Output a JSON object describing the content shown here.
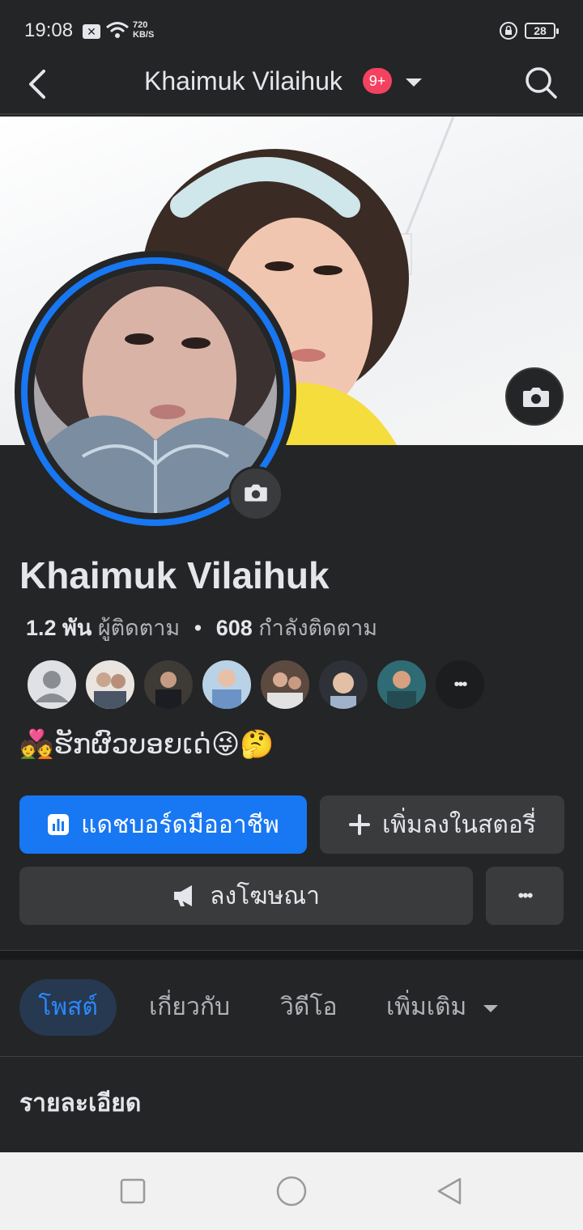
{
  "status_bar": {
    "time": "19:08",
    "speed_value": "720",
    "speed_unit": "KB/S",
    "battery": "28"
  },
  "header": {
    "title": "Khaimuk Vilaihuk",
    "badge": "9+"
  },
  "profile": {
    "name": "Khaimuk Vilaihuk",
    "followers_count": "1.2 พัน",
    "followers_label": "ผู้ติดตาม",
    "separator": "•",
    "following_count": "608",
    "following_label": "กำลังติดตาม",
    "bio": "💑ຮັກຜົວບອຍເດ່😜🤔"
  },
  "friends": {
    "more_label": "•••"
  },
  "actions": {
    "dashboard": "แดชบอร์ดมืออาชีพ",
    "add_story": "เพิ่มลงในสตอรี่",
    "advertise": "ลงโฆษณา",
    "more": "•••"
  },
  "tabs": {
    "posts": "โพสต์",
    "about": "เกี่ยวกับ",
    "videos": "วิดีโอ",
    "more": "เพิ่มเติม"
  },
  "details": {
    "title": "รายละเอียด"
  },
  "colors": {
    "accent": "#1877f2",
    "badge": "#f3425f",
    "background": "#242526"
  }
}
